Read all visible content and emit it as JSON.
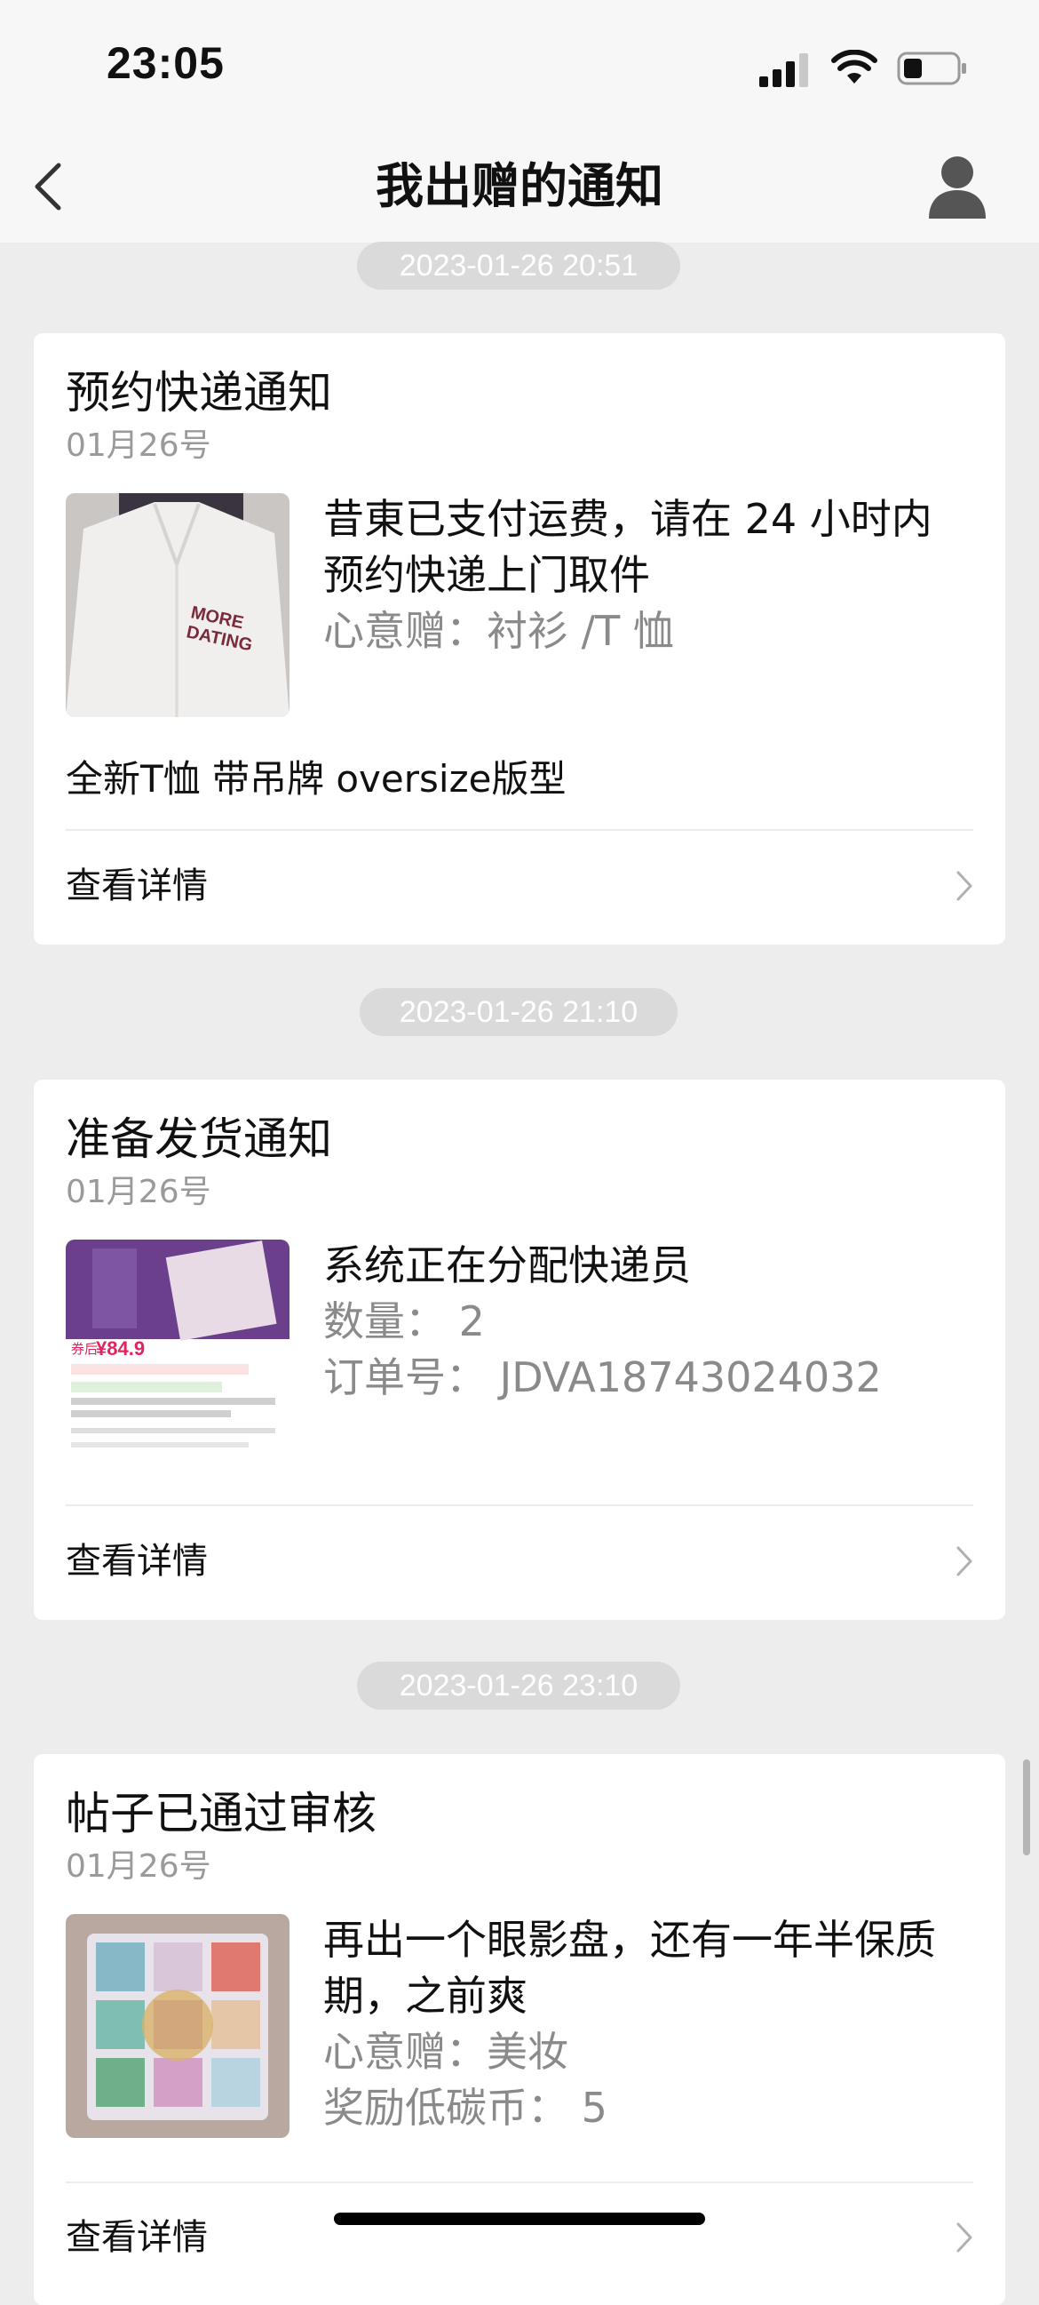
{
  "status": {
    "time": "23:05"
  },
  "nav": {
    "title": "我出赠的通知"
  },
  "notifications": [
    {
      "timestamp": "2023-01-26 20:51",
      "title": "预约快递通知",
      "date": "01月26号",
      "image": "white-hoodie-photo",
      "lines": [
        "昔東已支付运费，请在 24 小时内",
        "预约快递上门取件",
        "心意赠：衬衫 /T 恤"
      ],
      "note": "全新T恤 带吊牌 oversize版型",
      "detail_label": "查看详情"
    },
    {
      "timestamp": "2023-01-26 21:10",
      "title": "准备发货通知",
      "date": "01月26号",
      "image": "eyeshadow-listing-screenshot",
      "image_price": "¥84.9",
      "lines": [
        "系统正在分配快递员",
        "数量：  2",
        "订单号：  JDVA18743024032"
      ],
      "detail_label": "查看详情"
    },
    {
      "timestamp": "2023-01-26 23:10",
      "title": "帖子已通过审核",
      "date": "01月26号",
      "image": "eyeshadow-palette-photo",
      "lines": [
        "再出一个眼影盘，还有一年半保质",
        "期，之前爽",
        "心意赠：美妆",
        "奖励低碳币：  5"
      ],
      "detail_label": "查看详情"
    }
  ],
  "icons": {
    "back": "chevron-left-icon",
    "user": "user-icon",
    "detail": "chevron-right-icon"
  }
}
